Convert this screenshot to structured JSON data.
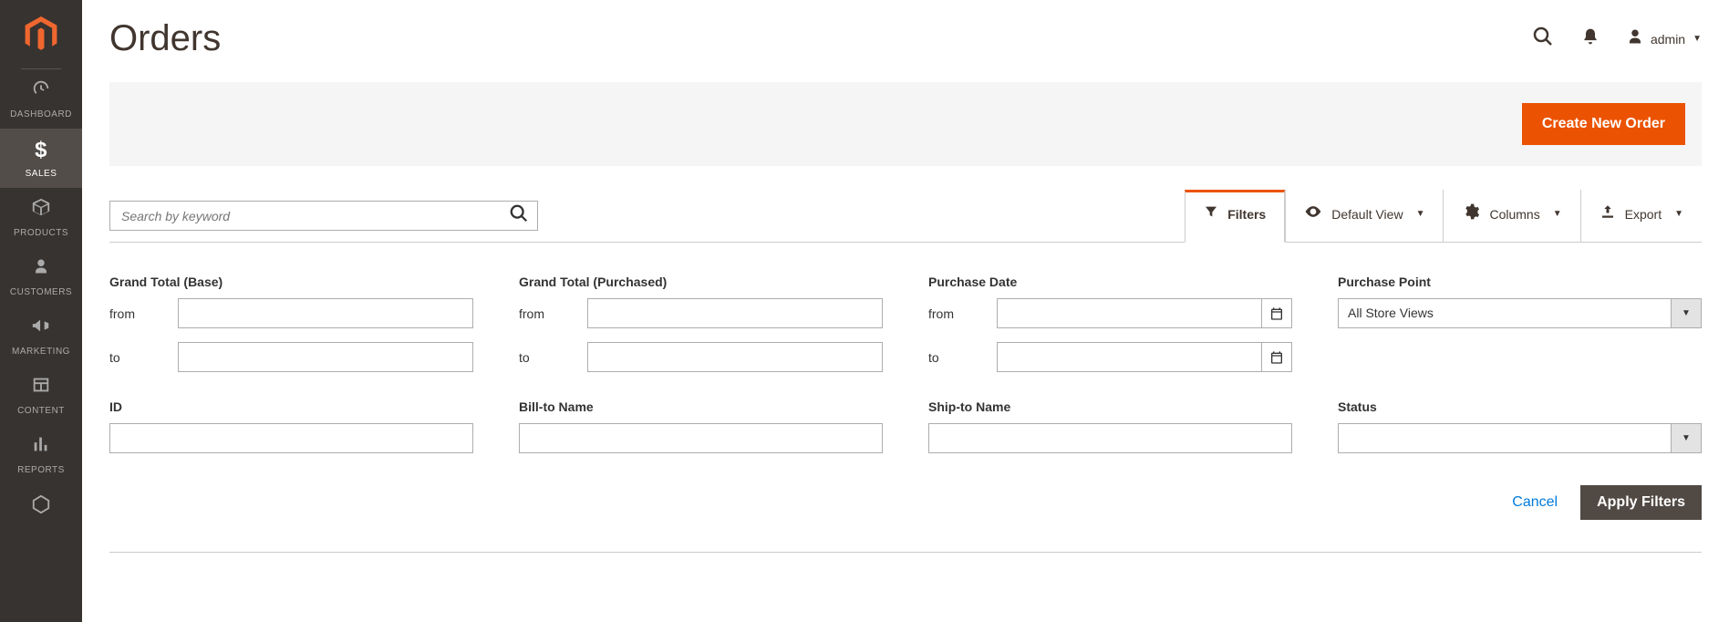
{
  "sidebar": {
    "items": [
      {
        "label": "DASHBOARD"
      },
      {
        "label": "SALES"
      },
      {
        "label": "PRODUCTS"
      },
      {
        "label": "CUSTOMERS"
      },
      {
        "label": "MARKETING"
      },
      {
        "label": "CONTENT"
      },
      {
        "label": "REPORTS"
      }
    ]
  },
  "header": {
    "title": "Orders",
    "user": "admin"
  },
  "banner": {
    "create_label": "Create New Order"
  },
  "toolbar": {
    "search_placeholder": "Search by keyword",
    "filters_label": "Filters",
    "default_view_label": "Default View",
    "columns_label": "Columns",
    "export_label": "Export"
  },
  "filters": {
    "grand_total_base": {
      "label": "Grand Total (Base)",
      "from_label": "from",
      "to_label": "to",
      "from": "",
      "to": ""
    },
    "grand_total_purchased": {
      "label": "Grand Total (Purchased)",
      "from_label": "from",
      "to_label": "to",
      "from": "",
      "to": ""
    },
    "purchase_date": {
      "label": "Purchase Date",
      "from_label": "from",
      "to_label": "to",
      "from": "",
      "to": ""
    },
    "purchase_point": {
      "label": "Purchase Point",
      "value": "All Store Views"
    },
    "id": {
      "label": "ID",
      "value": ""
    },
    "bill_to_name": {
      "label": "Bill-to Name",
      "value": ""
    },
    "ship_to_name": {
      "label": "Ship-to Name",
      "value": ""
    },
    "status": {
      "label": "Status",
      "value": ""
    }
  },
  "actions": {
    "cancel_label": "Cancel",
    "apply_label": "Apply Filters"
  }
}
